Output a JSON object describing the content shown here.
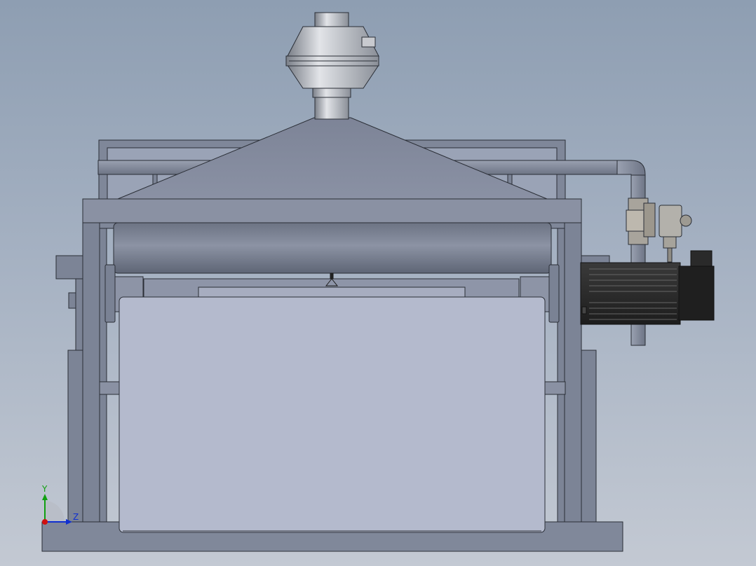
{
  "colors": {
    "background_top": "#8e9eb2",
    "background_bottom": "#c3c9d3",
    "steel": "#80889a",
    "steel_dark": "#6e7586",
    "panel": "#b4bacd",
    "motor": "#2b2b2b",
    "axis_x": "#d01010",
    "axis_y": "#10a010",
    "axis_z": "#1030d0"
  },
  "icons": {
    "triad": "coordinate-triad-icon"
  },
  "triad": {
    "y_label": "Y",
    "z_label": "Z"
  }
}
